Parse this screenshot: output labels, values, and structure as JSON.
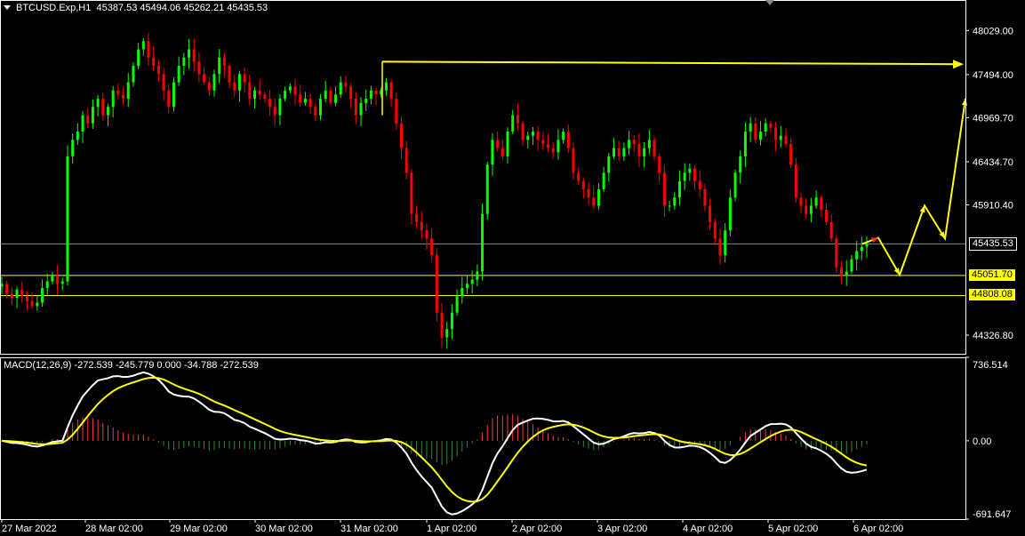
{
  "header": {
    "caret_icon": "dropdown-triangle-icon",
    "title": "BTCUSD.Exp,H1  45387.53 45494.06 45262.21 45435.53"
  },
  "macd_header": {
    "label": "MACD(12,26,9) -272.539 -245.779 0.000 -34.788 -272.539"
  },
  "colors": {
    "bull": "#00ff00",
    "bear": "#ff0000",
    "annotation": "#ffff00",
    "macd_line": "#ffffff",
    "signal_line": "#ffff00",
    "hist_pos": "#ff3b3b",
    "hist_neg": "#2e8b2e",
    "background": "#000000"
  },
  "price_tags": [
    {
      "value": "45435.53",
      "style": "current"
    },
    {
      "value": "45051.70",
      "style": "level"
    },
    {
      "value": "44808.08",
      "style": "level"
    }
  ],
  "chart_data": [
    {
      "type": "candlestick",
      "symbol": "BTCUSD.Exp",
      "timeframe": "H1",
      "last_bar": {
        "open": 45387.53,
        "high": 45494.06,
        "low": 45262.21,
        "close": 45435.53
      },
      "y_ticks": [
        "48029.00",
        "47494.00",
        "46969.70",
        "46434.70",
        "45910.40",
        "45435.53",
        "45051.70",
        "44808.08",
        "44326.80"
      ],
      "ylim": [
        44100,
        48400
      ],
      "x_ticks": [
        "27 Mar 2022",
        "28 Mar 02:00",
        "29 Mar 02:00",
        "30 Mar 02:00",
        "31 Mar 02:00",
        "1 Apr 02:00",
        "2 Apr 02:00",
        "3 Apr 02:00",
        "4 Apr 02:00",
        "5 Apr 02:00",
        "6 Apr 02:00"
      ],
      "hourly_closes_approx": [
        44950,
        44830,
        44780,
        44880,
        44800,
        44740,
        44680,
        44720,
        44900,
        44980,
        45050,
        44950,
        44980,
        46500,
        46700,
        46800,
        47000,
        46900,
        47100,
        47200,
        47000,
        47100,
        47300,
        47250,
        47200,
        47400,
        47600,
        47800,
        47900,
        47700,
        47600,
        47500,
        47300,
        47100,
        47400,
        47600,
        47700,
        47800,
        47650,
        47500,
        47400,
        47300,
        47500,
        47700,
        47600,
        47400,
        47300,
        47500,
        47400,
        47200,
        47300,
        47250,
        47200,
        47100,
        47000,
        47200,
        47300,
        47350,
        47250,
        47150,
        47200,
        47100,
        47000,
        47200,
        47300,
        47150,
        47250,
        47400,
        47350,
        47200,
        47000,
        47150,
        47200,
        47300,
        47250,
        47300,
        47400,
        47200,
        46900,
        46600,
        46300,
        45800,
        45700,
        45600,
        45500,
        45300,
        44600,
        44300,
        44400,
        44600,
        44800,
        44900,
        44950,
        45000,
        45100,
        45800,
        46400,
        46700,
        46600,
        46500,
        46800,
        47000,
        46900,
        46700,
        46750,
        46800,
        46700,
        46650,
        46600,
        46550,
        46700,
        46800,
        46600,
        46300,
        46200,
        46100,
        46000,
        45900,
        46100,
        46300,
        46500,
        46600,
        46500,
        46600,
        46700,
        46650,
        46500,
        46600,
        46700,
        46500,
        46300,
        45900,
        45900,
        46000,
        46200,
        46300,
        46350,
        46200,
        46100,
        45900,
        45700,
        45500,
        45300,
        45600,
        46000,
        46300,
        46500,
        46800,
        46900,
        46700,
        46800,
        46900,
        46850,
        46700,
        46750,
        46650,
        46400,
        46000,
        45900,
        45800,
        45900,
        46000,
        45850,
        45700,
        45500,
        45150,
        45050,
        45100,
        45250,
        45350,
        45400,
        45435.53
      ],
      "macd": {
        "range_labels": [
          "736.514",
          "0.00",
          "-691.647"
        ],
        "ylim": [
          -691.647,
          736.514
        ],
        "values": {
          "macd": -272.539,
          "signal": -245.779,
          "histogram": -34.788
        }
      },
      "annotations": [
        {
          "type": "horizontal_arrow",
          "from_price": 47650,
          "to_price": 47620,
          "label": ""
        },
        {
          "type": "zigzag_projection",
          "points": [
            45435,
            45510,
            45060,
            45900,
            45500,
            47200
          ]
        },
        {
          "type": "horizontal_line",
          "price": 45051.7
        },
        {
          "type": "horizontal_line",
          "price": 44808.08
        },
        {
          "type": "horizontal_line",
          "price": 45435.53,
          "style": "gray"
        }
      ]
    }
  ]
}
